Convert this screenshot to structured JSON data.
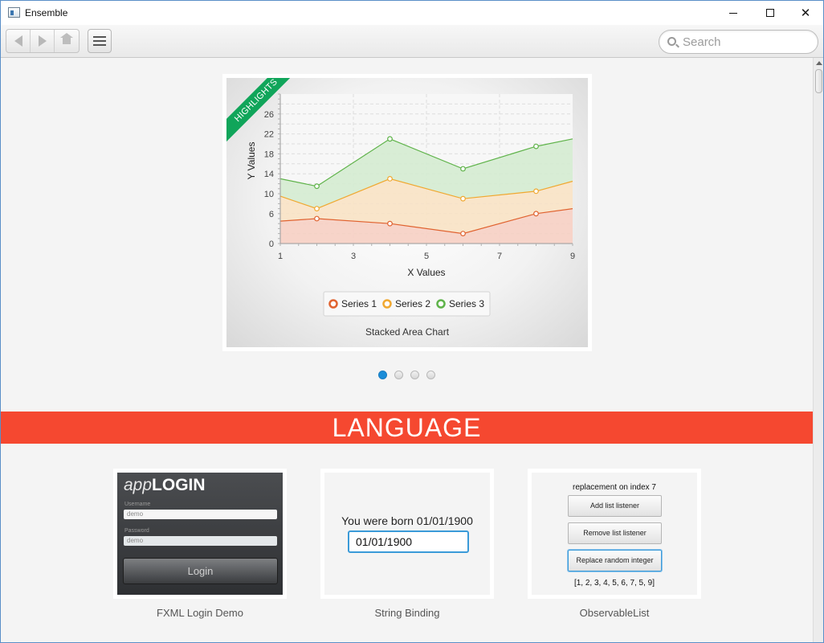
{
  "window": {
    "title": "Ensemble",
    "minimize_label": "—",
    "maximize_label": "",
    "close_label": "✕"
  },
  "toolbar": {
    "back_icon": "arrow-left-icon",
    "forward_icon": "arrow-right-icon",
    "home_icon": "home-icon",
    "menu_icon": "hamburger-menu-icon",
    "search_placeholder": "Search"
  },
  "highlight": {
    "ribbon": "HIGHLIGHTS",
    "caption": "Stacked Area Chart"
  },
  "chart_data": {
    "type": "area",
    "stacked": true,
    "title": "",
    "xlabel": "X Values",
    "ylabel": "Y Values",
    "xlim": [
      1,
      9
    ],
    "ylim": [
      0,
      30
    ],
    "x_ticks": [
      1,
      3,
      5,
      7,
      9
    ],
    "y_ticks": [
      0,
      6,
      10,
      14,
      18,
      22,
      26
    ],
    "grid": true,
    "legend": "bottom",
    "series": [
      {
        "name": "Series 1",
        "color": "#e06330",
        "fill": "#f6cfc3",
        "x": [
          1,
          2,
          4,
          6,
          8,
          9
        ],
        "values": [
          4.5,
          5,
          4,
          2,
          6,
          7
        ]
      },
      {
        "name": "Series 2",
        "color": "#f0a830",
        "fill": "#f8e2c4",
        "x": [
          1,
          2,
          4,
          6,
          8,
          9
        ],
        "values": [
          5,
          2,
          9,
          7,
          4.5,
          5.5
        ]
      },
      {
        "name": "Series 3",
        "color": "#5fb34a",
        "fill": "#d4ebd0",
        "x": [
          1,
          2,
          4,
          6,
          8,
          9
        ],
        "values": [
          3.5,
          4.5,
          8,
          6,
          9,
          8.5
        ]
      }
    ]
  },
  "pagination": {
    "count": 4,
    "active_index": 0
  },
  "section": {
    "title": "LANGUAGE"
  },
  "samples": [
    {
      "label": "FXML Login Demo",
      "logo_app": "app",
      "logo_login": "LOGIN",
      "username_label": "Username",
      "username_value": "demo",
      "password_label": "Password",
      "password_value": "demo",
      "button": "Login"
    },
    {
      "label": "String Binding",
      "text": "You were born 01/01/1900",
      "input_value": "01/01/1900"
    },
    {
      "label": "ObservableList",
      "title": "replacement on index 7",
      "btn_add": "Add list listener",
      "btn_remove": "Remove list listener",
      "btn_replace": "Replace random integer",
      "list": "[1, 2, 3, 4, 5, 6, 7, 5, 9]"
    }
  ]
}
